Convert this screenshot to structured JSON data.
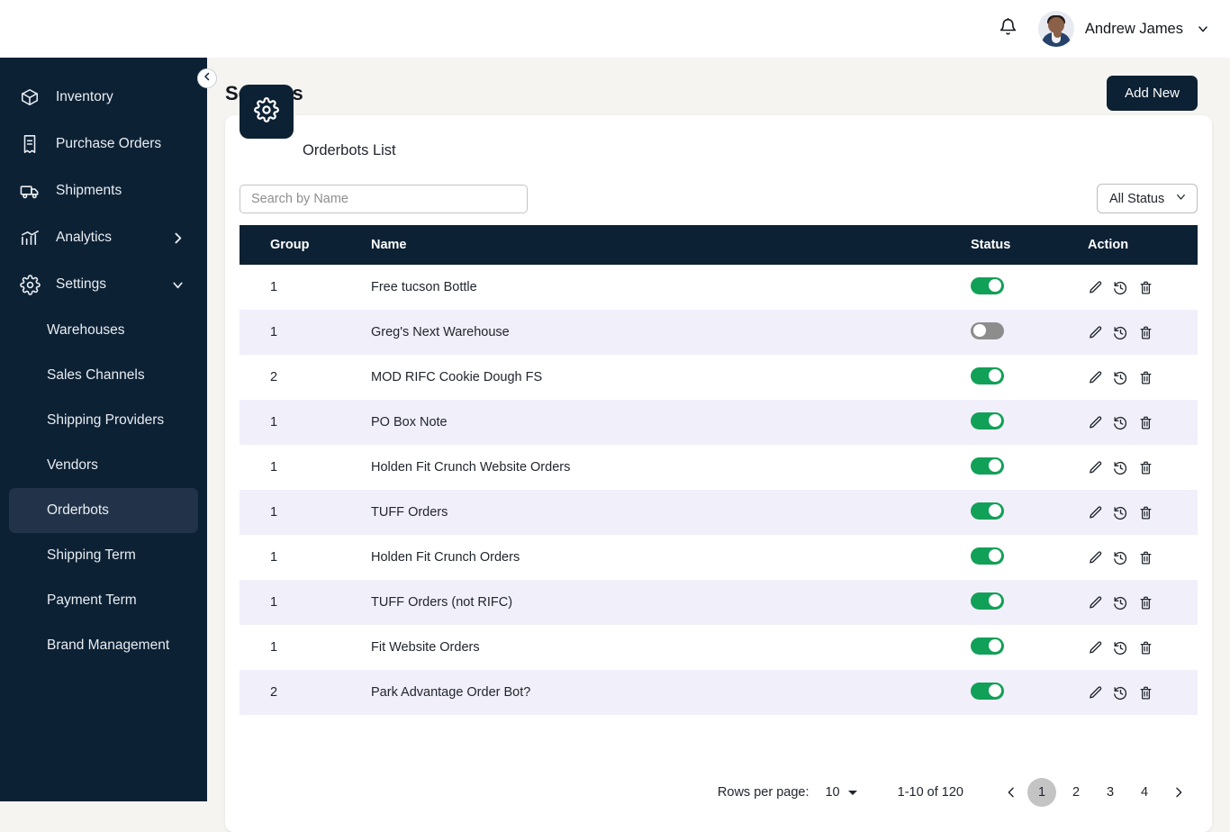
{
  "topbar": {
    "bell_icon": "bell-icon",
    "user_name": "Andrew James",
    "caret_icon": "chevron-down-icon"
  },
  "sidebar": {
    "items": [
      {
        "label": "Inventory",
        "icon": "box-icon",
        "arrow": ""
      },
      {
        "label": "Purchase Orders",
        "icon": "receipt-icon",
        "arrow": ""
      },
      {
        "label": "Shipments",
        "icon": "truck-icon",
        "arrow": ""
      },
      {
        "label": "Analytics",
        "icon": "chart-icon",
        "arrow": "chevron-right-icon"
      },
      {
        "label": "Settings",
        "icon": "gear-icon",
        "arrow": "chevron-down-icon"
      }
    ],
    "sub_items": [
      {
        "label": "Warehouses",
        "active": false
      },
      {
        "label": "Sales Channels",
        "active": false
      },
      {
        "label": "Shipping Providers",
        "active": false
      },
      {
        "label": "Vendors",
        "active": false
      },
      {
        "label": "Orderbots",
        "active": true
      },
      {
        "label": "Shipping Term",
        "active": false
      },
      {
        "label": "Payment Term",
        "active": false
      },
      {
        "label": "Brand Management",
        "active": false
      }
    ],
    "collapse_icon": "chevron-left-icon"
  },
  "page": {
    "title": "Settings",
    "add_button": "Add New",
    "card_title": "Orderbots List",
    "card_icon": "gear-icon"
  },
  "filters": {
    "search_placeholder": "Search by Name",
    "search_value": "",
    "status_value": "All Status",
    "status_caret": "chevron-down-icon"
  },
  "table": {
    "columns": [
      "Group",
      "Name",
      "Status",
      "Action"
    ],
    "rows": [
      {
        "group": "1",
        "name": "Free tucson Bottle",
        "status": "on"
      },
      {
        "group": "1",
        "name": "Greg's Next Warehouse",
        "status": "off"
      },
      {
        "group": "2",
        "name": "MOD RIFC Cookie Dough FS",
        "status": "on"
      },
      {
        "group": "1",
        "name": "PO Box Note",
        "status": "on"
      },
      {
        "group": "1",
        "name": " Holden Fit Crunch Website Orders",
        "status": "on"
      },
      {
        "group": "1",
        "name": "TUFF Orders",
        "status": "on"
      },
      {
        "group": "1",
        "name": "Holden Fit Crunch Orders",
        "status": "on"
      },
      {
        "group": "1",
        "name": "TUFF Orders (not RIFC)",
        "status": "on"
      },
      {
        "group": "1",
        "name": "Fit Website Orders",
        "status": "on"
      },
      {
        "group": "2",
        "name": "Park Advantage Order Bot?",
        "status": "on"
      }
    ],
    "action_icons": [
      "edit-pencil-icon",
      "history-icon",
      "trash-icon"
    ]
  },
  "pagination": {
    "rows_per_page_label": "Rows per page:",
    "rows_per_page_value": "10",
    "range": "1-10 of 120",
    "prev_icon": "chevron-left-icon",
    "next_icon": "chevron-right-icon",
    "pages": [
      "1",
      "2",
      "3",
      "4"
    ],
    "current_page": "1"
  },
  "colors": {
    "navy": "#0c2134",
    "toggle_on": "#11a057",
    "toggle_off": "#8d8d8d",
    "page_bg": "#f5f4f1",
    "row_alt": "#f1effa"
  }
}
